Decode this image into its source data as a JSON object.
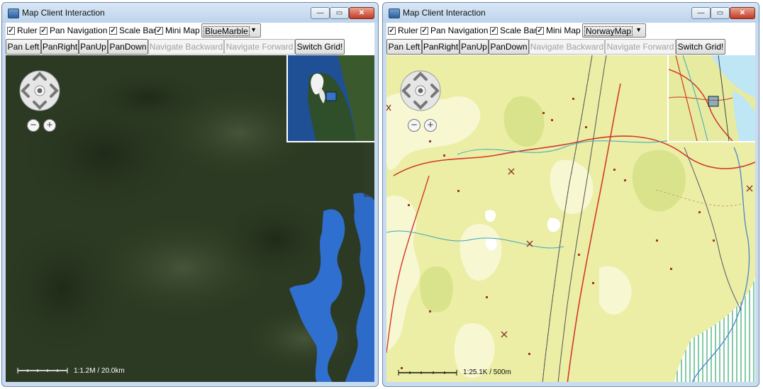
{
  "windows": [
    {
      "title": "Map Client Interaction",
      "checkboxes": [
        {
          "label": "Ruler",
          "checked": "✓"
        },
        {
          "label": "Pan Navigation",
          "checked": "✓"
        },
        {
          "label": "Scale Bar",
          "checked": "✓"
        },
        {
          "label": "Mini Map",
          "checked": "✓"
        }
      ],
      "map_select": "BlueMarble",
      "buttons": {
        "pan_left": "Pan Left",
        "pan_right": "PanRight",
        "pan_up": "PanUp",
        "pan_down": "PanDown",
        "nav_back": "Navigate Backward",
        "nav_forward": "Navigate Forward",
        "switch_grid": "Switch Grid!"
      },
      "scale_text": "1:1.2M / 20.0km",
      "zoom_out": "−",
      "zoom_in": "+"
    },
    {
      "title": "Map Client Interaction",
      "checkboxes": [
        {
          "label": "Ruler",
          "checked": "✓"
        },
        {
          "label": "Pan Navigation",
          "checked": "✓"
        },
        {
          "label": "Scale Bar",
          "checked": "✓"
        },
        {
          "label": "Mini Map",
          "checked": "✓"
        }
      ],
      "map_select": "NorwayMap",
      "buttons": {
        "pan_left": "Pan Left",
        "pan_right": "PanRight",
        "pan_up": "PanUp",
        "pan_down": "PanDown",
        "nav_back": "Navigate Backward",
        "nav_forward": "Navigate Forward",
        "switch_grid": "Switch Grid!"
      },
      "scale_text": "1:25.1K / 500m",
      "zoom_out": "−",
      "zoom_in": "+"
    }
  ],
  "window_controls": {
    "minimize": "—",
    "maximize": "▭",
    "close": "✕"
  },
  "colors": {
    "titlebar": "#c9dcef",
    "satellite_forest": "#2b3822",
    "water_blue": "#2f6fd0",
    "topo_yellow": "#ecefa2",
    "road_red": "#d2382c"
  }
}
